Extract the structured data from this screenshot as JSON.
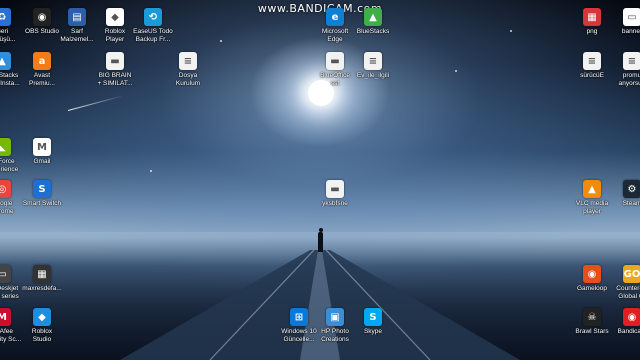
{
  "watermark": {
    "url": "www.BANDICAM.com"
  },
  "icons": [
    {
      "label": "Geri\ndönüşü...",
      "icon": "recycle-bin-icon",
      "color": "#2a6fd1",
      "glyph": "♻"
    },
    {
      "label": "OBS Studio",
      "icon": "obs-studio-icon",
      "color": "#222222",
      "glyph": "◉"
    },
    {
      "label": "Sarf\nMalzemel...",
      "icon": "sarf-malzeme-icon",
      "color": "#2b5fa8",
      "glyph": "▤"
    },
    {
      "label": "Roblox\nPlayer",
      "icon": "roblox-player-icon",
      "color": "#ffffff",
      "glyph": "◆"
    },
    {
      "label": "EaseUS Todo\nBackup Fr...",
      "icon": "easeus-backup-icon",
      "color": "#1a9bd7",
      "glyph": "⟲"
    },
    {
      "label": "Microsoft\nEdge",
      "icon": "edge-icon",
      "color": "#0f7fd2",
      "glyph": "e"
    },
    {
      "label": "BlueStacks",
      "icon": "bluestacks-icon",
      "color": "#3fae49",
      "glyph": "▲"
    },
    {
      "label": "png",
      "icon": "png-image-icon",
      "color": "#d8343c",
      "glyph": "▦"
    },
    {
      "label": "banner",
      "icon": "banner-image-icon",
      "color": "#ffffff",
      "glyph": "▭"
    },
    {
      "label": "BlueStacks\nMulti-Insta...",
      "icon": "bluestacks-multi-icon",
      "color": "#2f8fdd",
      "glyph": "▲"
    },
    {
      "label": "Avast\nPremiu...",
      "icon": "avast-icon",
      "color": "#f07c1a",
      "glyph": "a"
    },
    {
      "label": "BIG BRAIN\n+ SIMILAT...",
      "icon": "document-icon",
      "color": "#f2f2f2",
      "glyph": "▬"
    },
    {
      "label": "Dosya\nKurulum",
      "icon": "text-file-icon",
      "color": "#f2f2f2",
      "glyph": "≡"
    },
    {
      "label": "BlueOffice\nsst",
      "icon": "file-icon",
      "color": "#f2f2f2",
      "glyph": "▬"
    },
    {
      "label": "Ev_ile_ilgili",
      "icon": "text-file-icon",
      "color": "#f2f2f2",
      "glyph": "≡"
    },
    {
      "label": "sürücüE",
      "icon": "text-file-icon",
      "color": "#f2f2f2",
      "glyph": "≡"
    },
    {
      "label": "promu\nanyorsun",
      "icon": "text-file-icon",
      "color": "#f2f2f2",
      "glyph": "≡"
    },
    {
      "label": "GeForce\nExperience",
      "icon": "geforce-experience-icon",
      "color": "#76b900",
      "glyph": "◣"
    },
    {
      "label": "Gmail",
      "icon": "gmail-icon",
      "color": "#ffffff",
      "glyph": "M"
    },
    {
      "label": "Google\nChrome",
      "icon": "chrome-icon",
      "color": "#e8453c",
      "glyph": "◎"
    },
    {
      "label": "Smart Switch",
      "icon": "smart-switch-icon",
      "color": "#1f6fd0",
      "glyph": "S"
    },
    {
      "label": "yksbfsne",
      "icon": "file-icon",
      "color": "#f2f2f2",
      "glyph": "▬"
    },
    {
      "label": "VLC media\nplayer",
      "icon": "vlc-icon",
      "color": "#f28b0c",
      "glyph": "▲"
    },
    {
      "label": "Steam",
      "icon": "steam-icon",
      "color": "#1b2838",
      "glyph": "⚙"
    },
    {
      "label": "HP Deskjet\n2130 series",
      "icon": "hp-printer-icon",
      "color": "#444444",
      "glyph": "▭"
    },
    {
      "label": "maxresdefa...",
      "icon": "image-file-icon",
      "color": "#333333",
      "glyph": "▦"
    },
    {
      "label": "Gameloop",
      "icon": "gameloop-icon",
      "color": "#e84e1b",
      "glyph": "◉"
    },
    {
      "label": "Counter-St\nGlobal Of",
      "icon": "csgo-icon",
      "color": "#e9a820",
      "glyph": "GO"
    },
    {
      "label": "McAfee\nSecurity Sc...",
      "icon": "mcafee-icon",
      "color": "#c8102e",
      "glyph": "M"
    },
    {
      "label": "Roblox\nStudio",
      "icon": "roblox-studio-icon",
      "color": "#1d8de0",
      "glyph": "◆"
    },
    {
      "label": "Windows 10\nGüncelle...",
      "icon": "windows-update-icon",
      "color": "#0a78d6",
      "glyph": "⊞"
    },
    {
      "label": "HP Photo\nCreations",
      "icon": "hp-photo-icon",
      "color": "#3a8ed8",
      "glyph": "▣"
    },
    {
      "label": "Skype",
      "icon": "skype-icon",
      "color": "#00a9f0",
      "glyph": "S"
    },
    {
      "label": "Brawl Stars",
      "icon": "brawl-stars-icon",
      "color": "#222222",
      "glyph": "☠"
    },
    {
      "label": "Bandicam",
      "icon": "bandicam-icon",
      "color": "#e02020",
      "glyph": "◉"
    }
  ]
}
